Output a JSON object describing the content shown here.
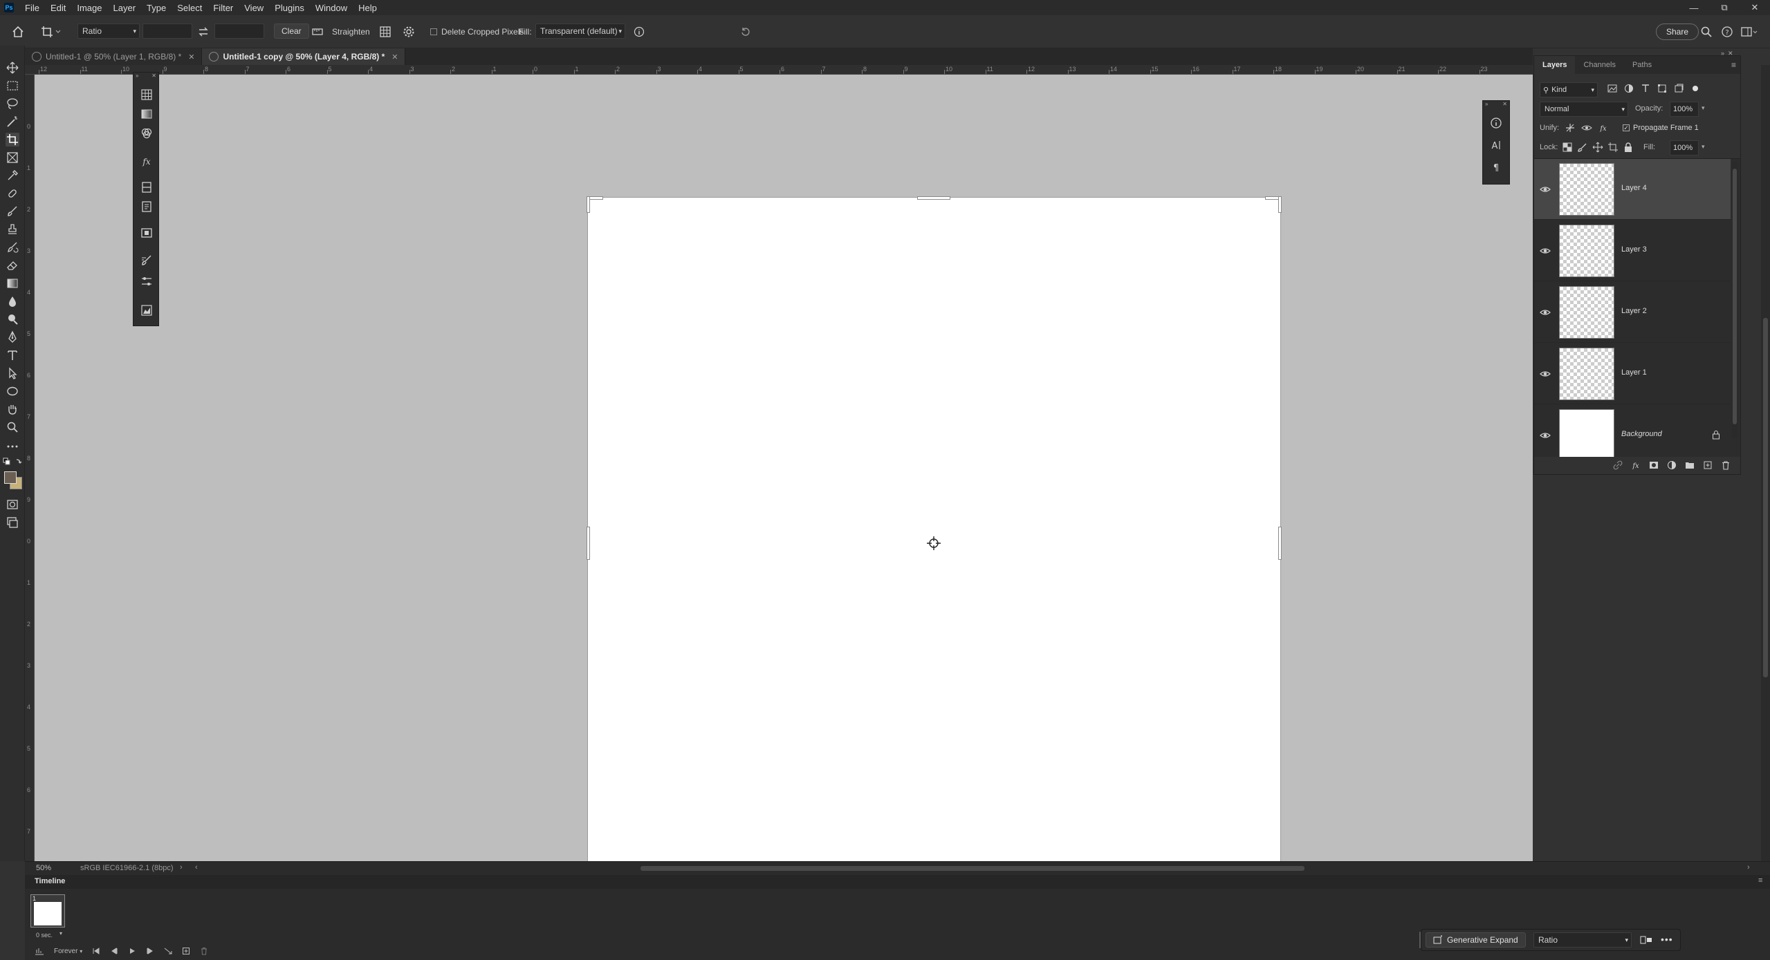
{
  "menubar": {
    "logo": "Ps",
    "items": [
      "File",
      "Edit",
      "Image",
      "Layer",
      "Type",
      "Select",
      "Filter",
      "View",
      "Plugins",
      "Window",
      "Help"
    ]
  },
  "options": {
    "ratio_select": "Ratio",
    "clear_label": "Clear",
    "straighten_label": "Straighten",
    "delete_cropped_label": "Delete Cropped Pixels",
    "fill_label": "Fill:",
    "fill_select": "Transparent (default)",
    "share_label": "Share"
  },
  "tabs": [
    {
      "label": "Untitled-1 @ 50% (Layer 1, RGB/8) *",
      "active": false
    },
    {
      "label": "Untitled-1 copy @ 50% (Layer 4, RGB/8) *",
      "active": true
    }
  ],
  "ruler_h": [
    "12",
    "11",
    "10",
    "9",
    "8",
    "7",
    "6",
    "5",
    "4",
    "3",
    "2",
    "1",
    "0",
    "1",
    "2",
    "3",
    "4",
    "5",
    "6",
    "7",
    "8",
    "9",
    "10",
    "11",
    "12",
    "13",
    "14",
    "15",
    "16",
    "17",
    "18",
    "19",
    "20",
    "21",
    "22",
    "23"
  ],
  "ruler_v": [
    "0",
    "1",
    "2",
    "3",
    "4",
    "5",
    "6",
    "7",
    "8",
    "9",
    "0",
    "1",
    "2",
    "3",
    "4",
    "5",
    "6",
    "7"
  ],
  "layers_panel": {
    "tabs": [
      "Layers",
      "Channels",
      "Paths"
    ],
    "kind_label": "Kind",
    "blend_mode": "Normal",
    "opacity_label": "Opacity:",
    "opacity_value": "100%",
    "unify_label": "Unify:",
    "propagate_label": "Propagate Frame 1",
    "lock_label": "Lock:",
    "fill_label": "Fill:",
    "fill_value": "100%",
    "layers": [
      {
        "name": "Layer 4",
        "selected": true,
        "transparent": true
      },
      {
        "name": "Layer 3",
        "selected": false,
        "transparent": true
      },
      {
        "name": "Layer 2",
        "selected": false,
        "transparent": true
      },
      {
        "name": "Layer 1",
        "selected": false,
        "transparent": true
      },
      {
        "name": "Background",
        "selected": false,
        "transparent": false,
        "locked": true
      }
    ]
  },
  "status": {
    "zoom": "50%",
    "profile": "sRGB IEC61966-2.1 (8bpc)"
  },
  "timeline": {
    "title": "Timeline",
    "frame_number": "1",
    "frame_delay": "0 sec.",
    "loop": "Forever"
  },
  "taskbar": {
    "generative_expand": "Generative Expand",
    "ratio": "Ratio"
  },
  "colors": {
    "canvas_bg": "#bebebe",
    "foreground_swatch": "#6b5f54",
    "background_swatch": "#c8b27a",
    "accent": "#31a8ff"
  }
}
